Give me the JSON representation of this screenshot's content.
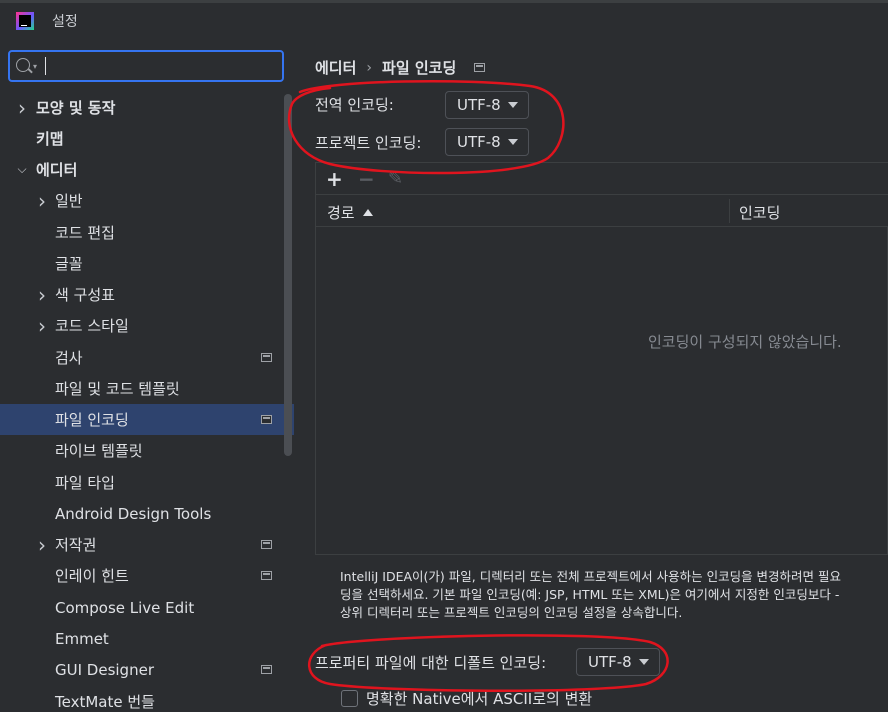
{
  "window": {
    "title": "설정"
  },
  "search": {
    "placeholder": "",
    "value": ""
  },
  "sidebar": {
    "items": [
      {
        "label": "모양 및 동작",
        "bold": true,
        "arrow": "right",
        "has_project_icon": false
      },
      {
        "label": "키맵",
        "bold": true,
        "arrow": "",
        "has_project_icon": false
      },
      {
        "label": "에디터",
        "bold": true,
        "arrow": "down",
        "has_project_icon": false
      },
      {
        "label": "일반",
        "bold": false,
        "arrow": "right",
        "has_project_icon": false
      },
      {
        "label": "코드 편집",
        "bold": false,
        "arrow": "",
        "has_project_icon": false
      },
      {
        "label": "글꼴",
        "bold": false,
        "arrow": "",
        "has_project_icon": false
      },
      {
        "label": "색 구성표",
        "bold": false,
        "arrow": "right",
        "has_project_icon": false
      },
      {
        "label": "코드 스타일",
        "bold": false,
        "arrow": "right",
        "has_project_icon": false
      },
      {
        "label": "검사",
        "bold": false,
        "arrow": "",
        "has_project_icon": true
      },
      {
        "label": "파일 및 코드 템플릿",
        "bold": false,
        "arrow": "",
        "has_project_icon": false
      },
      {
        "label": "파일 인코딩",
        "bold": false,
        "arrow": "",
        "has_project_icon": true,
        "selected": true
      },
      {
        "label": "라이브 템플릿",
        "bold": false,
        "arrow": "",
        "has_project_icon": false
      },
      {
        "label": "파일 타입",
        "bold": false,
        "arrow": "",
        "has_project_icon": false
      },
      {
        "label": "Android Design Tools",
        "bold": false,
        "arrow": "",
        "has_project_icon": false
      },
      {
        "label": "저작권",
        "bold": false,
        "arrow": "right",
        "has_project_icon": true
      },
      {
        "label": "인레이 힌트",
        "bold": false,
        "arrow": "",
        "has_project_icon": true
      },
      {
        "label": "Compose Live Edit",
        "bold": false,
        "arrow": "",
        "has_project_icon": false
      },
      {
        "label": "Emmet",
        "bold": false,
        "arrow": "",
        "has_project_icon": false
      },
      {
        "label": "GUI Designer",
        "bold": false,
        "arrow": "",
        "has_project_icon": true
      },
      {
        "label": "TextMate 번들",
        "bold": false,
        "arrow": "",
        "has_project_icon": false
      }
    ]
  },
  "breadcrumb": {
    "parent": "에디터",
    "separator": "›",
    "current": "파일 인코딩"
  },
  "global_encoding": {
    "label": "전역 인코딩:",
    "value": "UTF-8"
  },
  "project_encoding": {
    "label": "프로젝트 인코딩:",
    "value": "UTF-8"
  },
  "toolbar": {
    "add": "+",
    "remove": "−",
    "edit": "✎"
  },
  "table": {
    "columns": [
      "경로",
      "인코딩"
    ],
    "empty_text": "인코딩이 구성되지 않았습니다."
  },
  "description": {
    "line1": "IntelliJ IDEA이(가) 파일, 디렉터리 또는 전체 프로젝트에서 사용하는 인코딩을 변경하려면 필요",
    "line2": "딩을 선택하세요. 기본 파일 인코딩(예: JSP, HTML 또는 XML)은 여기에서 지정한 인코딩보다 -",
    "line3": "상위 디렉터리 또는 프로젝트 인코딩의 인코딩 설정을 상속합니다."
  },
  "properties_encoding": {
    "label": "프로퍼티 파일에 대한 디폴트 인코딩:",
    "value": "UTF-8"
  },
  "native_to_ascii": {
    "label": "명확한 Native에서 ASCII로의 변환",
    "checked": false
  },
  "colors": {
    "background": "#2b2d30",
    "selection": "#2e436e",
    "focus_border": "#3574f0",
    "annotation": "#e0141e"
  }
}
